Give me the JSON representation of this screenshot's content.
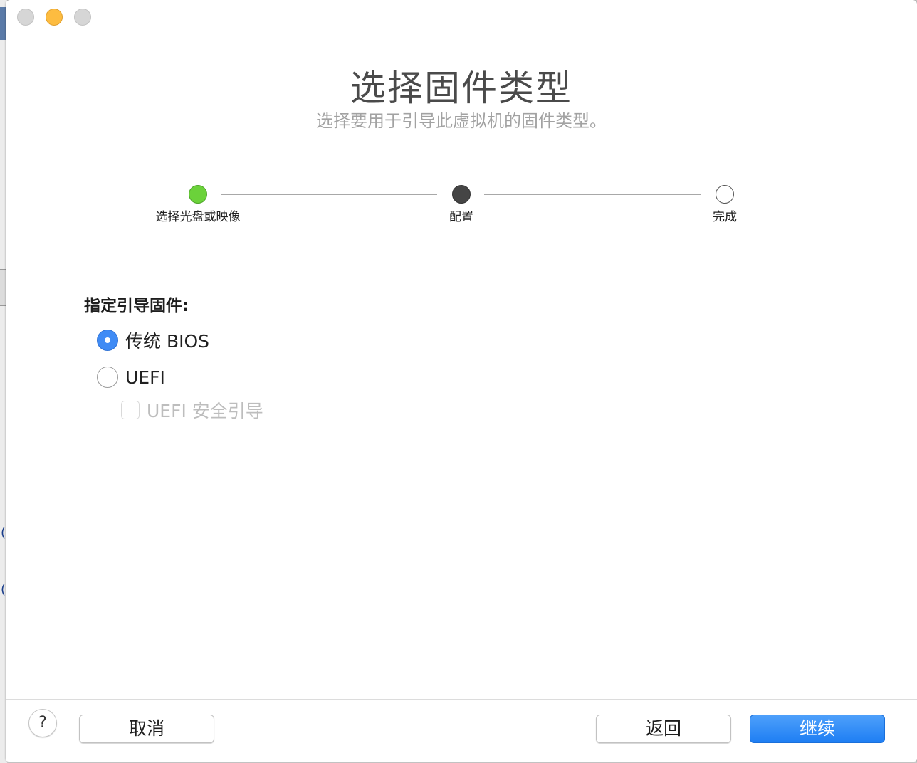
{
  "dialog": {
    "title": "选择固件类型",
    "subtitle": "选择要用于引导此虚拟机的固件类型。"
  },
  "steps": [
    {
      "label": "选择光盘或映像",
      "state": "done"
    },
    {
      "label": "配置",
      "state": "current"
    },
    {
      "label": "完成",
      "state": "pending"
    }
  ],
  "firmware": {
    "section_label": "指定引导固件:",
    "options": [
      {
        "label": "传统 BIOS",
        "selected": true
      },
      {
        "label": "UEFI",
        "selected": false
      }
    ],
    "secure_boot": {
      "label": "UEFI 安全引导",
      "checked": false,
      "enabled": false
    }
  },
  "footer": {
    "help_label": "?",
    "cancel_label": "取消",
    "back_label": "返回",
    "continue_label": "继续"
  },
  "colors": {
    "accent": "#3f8bf5",
    "step_done": "#6bd23a",
    "step_current": "#454545",
    "minimize": "#fdbc40"
  }
}
